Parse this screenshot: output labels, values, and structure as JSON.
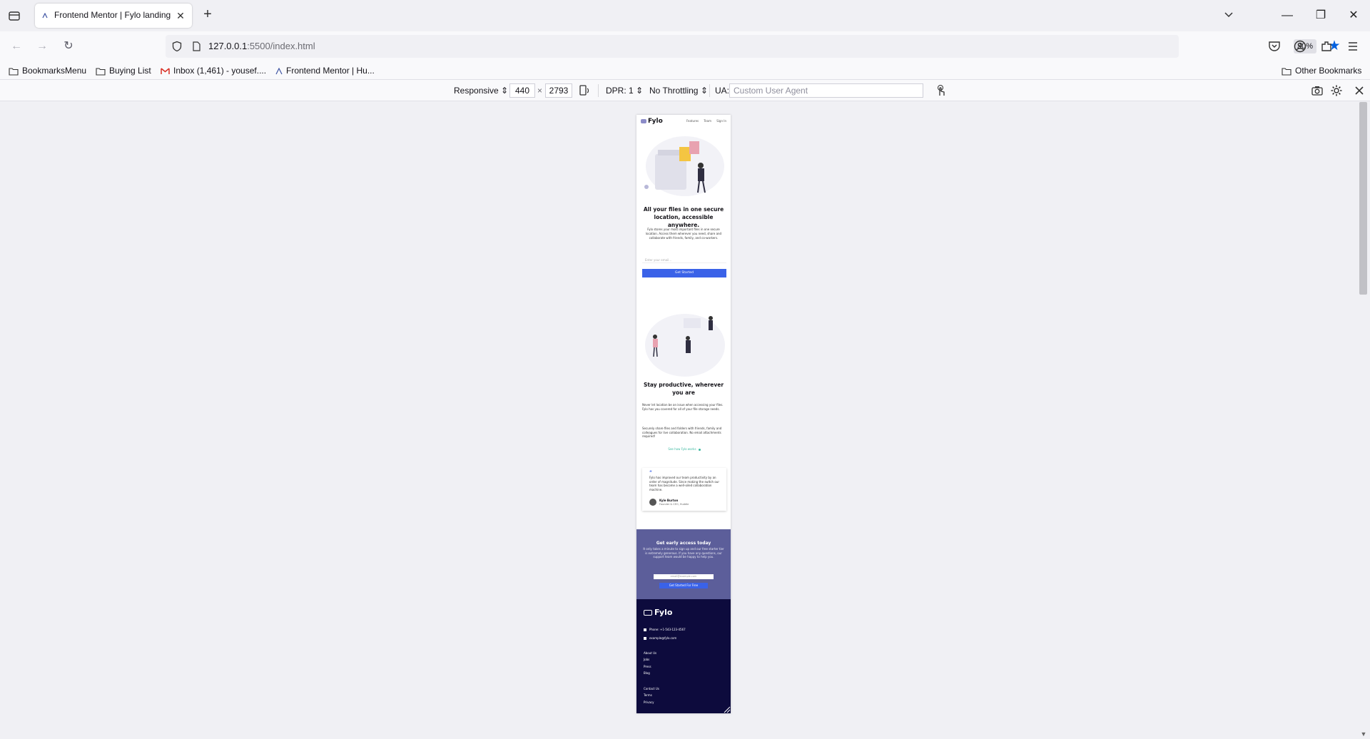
{
  "tab": {
    "title": "Frontend Mentor | Fylo landing",
    "close": "✕",
    "new": "+"
  },
  "window": {
    "minimize": "—",
    "restore": "❐",
    "close": "✕"
  },
  "nav": {
    "back": "←",
    "forward": "→",
    "reload": "↻",
    "url_host": "127.0.0.1",
    "url_path": ":5500/index.html",
    "zoom": "30%",
    "bookmark_star": "★"
  },
  "bookmarks": {
    "items": [
      {
        "label": "BookmarksMenu",
        "icon": "folder-icon"
      },
      {
        "label": "Buying List",
        "icon": "folder-icon"
      },
      {
        "label": "Inbox (1,461) - yousef....",
        "icon": "gmail-icon"
      },
      {
        "label": "Frontend Mentor | Hu...",
        "icon": "frontend-mentor-icon"
      }
    ],
    "other": "Other Bookmarks"
  },
  "rdm": {
    "device": "Responsive",
    "width": "440",
    "times": "×",
    "height": "2793",
    "dpr": "DPR: 1",
    "throttling": "No Throttling",
    "ua_label": "UA:",
    "ua_placeholder": "Custom User Agent"
  },
  "site": {
    "logo": "Fylo",
    "nav": [
      "Features",
      "Team",
      "Sign In"
    ],
    "hero_title": "All your files in one secure location, accessible anywhere.",
    "hero_text": "Fylo stores your most important files in one secure location. Access them wherever you need, share and collaborate with friends, family, and co-workers.",
    "email_placeholder": "Enter your email...",
    "cta_button": "Get Started",
    "productive_title": "Stay productive, wherever you are",
    "productive_p1": "Never let location be an issue when accessing your files. Fylo has you covered for all of your file storage needs.",
    "productive_p2": "Securely share files and folders with friends, family and colleagues for live collaboration. No email attachments required!",
    "see_how": "See how Fylo works",
    "testimonial_quote_mark": "“",
    "testimonial": "Fylo has improved our team productivity by an order of magnitude. Since making the switch our team has become a well-oiled collaboration machine.",
    "testimonial_name": "Kyle Burton",
    "testimonial_role": "Founder & CEO, Huddle",
    "access_title": "Get early access today",
    "access_text": "It only takes a minute to sign up and our free starter tier is extremely generous. If you have any questions, our support team would be happy to help you.",
    "access_placeholder": "email@example.com",
    "access_button": "Get Started For Free",
    "footer_logo": "Fylo",
    "footer_phone": "Phone: +1-543-123-4567",
    "footer_email": "example@fylo.com",
    "footer_links_1": [
      "About Us",
      "Jobs",
      "Press",
      "Blog"
    ],
    "footer_links_2": [
      "Contact Us",
      "Terms",
      "Privacy"
    ]
  }
}
